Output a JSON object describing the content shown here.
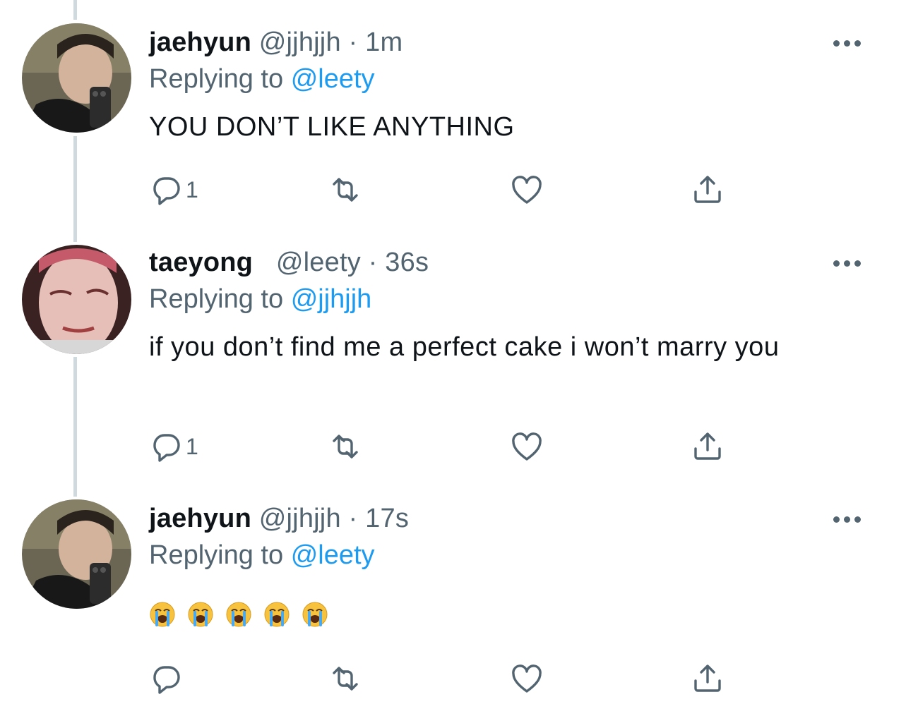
{
  "tweets": [
    {
      "name": "jaehyun",
      "handle": "@jjhjjh",
      "sep": "·",
      "time": "1m",
      "replying_prefix": "Replying to",
      "replying_to": "@leety",
      "text": "YOU DON’T LIKE ANYTHING",
      "reply_count": "1",
      "avatar_icon": "profile-photo"
    },
    {
      "name": "taeyong",
      "handle": "@leety",
      "sep": "·",
      "time": "36s",
      "replying_prefix": "Replying to",
      "replying_to": "@jjhjjh",
      "text": "if you don’t find me a perfect cake i won’t marry you",
      "reply_count": "1",
      "avatar_icon": "profile-photo"
    },
    {
      "name": "jaehyun",
      "handle": "@jjhjjh",
      "sep": "·",
      "time": "17s",
      "replying_prefix": "Replying to",
      "replying_to": "@leety",
      "emojis": [
        "😭",
        "😭",
        "😭",
        "😭",
        "😭"
      ],
      "reply_count": "",
      "avatar_icon": "profile-photo"
    }
  ],
  "icons": {
    "reply": "reply-icon",
    "retweet": "retweet-icon",
    "like": "heart-icon",
    "share": "share-icon",
    "more": "more-icon"
  },
  "colors": {
    "text": "#0f1419",
    "muted": "#536471",
    "mention": "#1d9bf0",
    "thread_line": "#cfd9de"
  }
}
